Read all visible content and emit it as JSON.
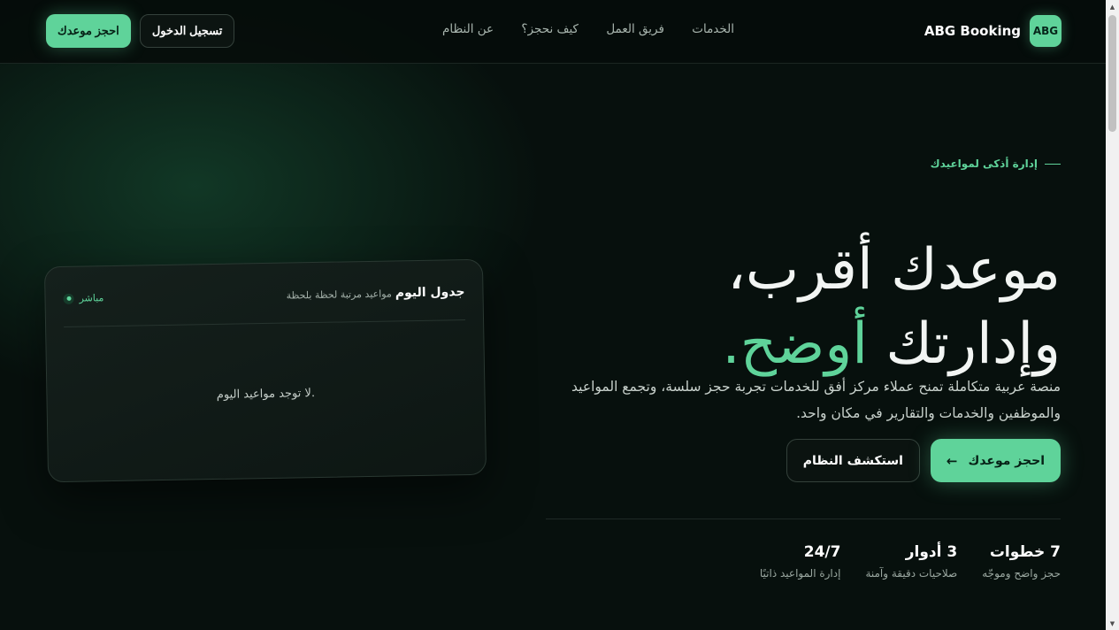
{
  "header": {
    "brand_logo": "ABG",
    "brand_name": "ABG Booking",
    "nav": [
      "الخدمات",
      "فريق العمل",
      "كيف نحجز؟",
      "عن النظام"
    ],
    "login_label": "تسجيل الدخول",
    "book_label": "احجز موعدك"
  },
  "hero": {
    "eyebrow": "إدارة أذكى لمواعيدك",
    "headline_line1": "موعدك أقرب،",
    "headline_line2_part1": "وإدارتك ",
    "headline_line2_accent": "أوضح.",
    "lead": "منصة عربية متكاملة تمنح عملاء مركز أفق للخدمات تجربة حجز سلسة، وتجمع المواعيد والموظفين والخدمات والتقارير في مكان واحد.",
    "cta_primary": "احجز موعدك",
    "cta_secondary": "استكشف النظام",
    "stats": [
      {
        "value": "7 خطوات",
        "label": "حجز واضح وموجّه"
      },
      {
        "value": "3 أدوار",
        "label": "صلاحيات دقيقة وآمنة"
      },
      {
        "value": "24/7",
        "label": "إدارة المواعيد ذاتيًا"
      }
    ]
  },
  "schedule_card": {
    "title": "جدول اليوم",
    "subtitle": "مواعيد مرتبة لحظة بلحظة",
    "live_label": "مباشر",
    "empty_text": "لا توجد مواعيد اليوم."
  },
  "colors": {
    "accent": "#5fd39a",
    "background": "#07100d"
  }
}
